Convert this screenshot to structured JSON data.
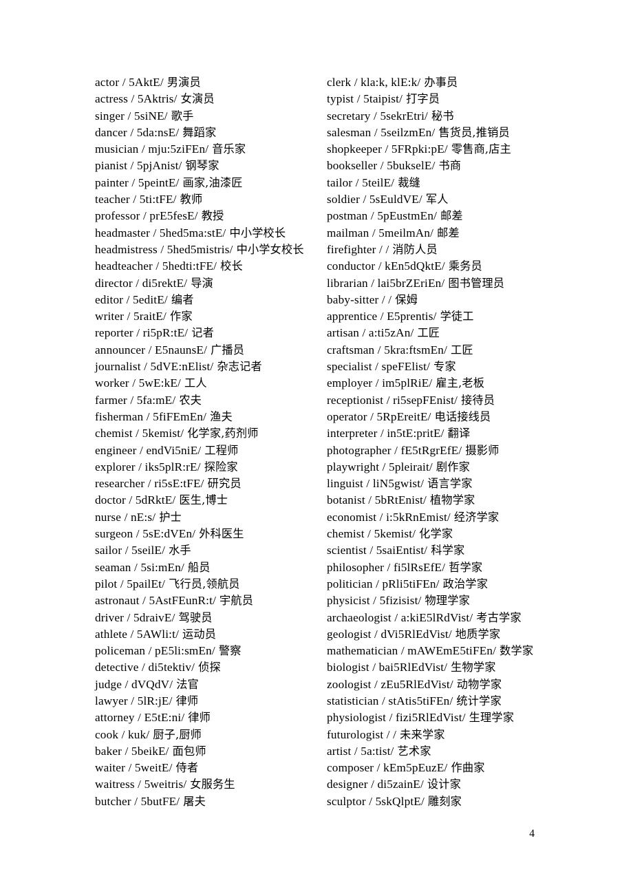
{
  "document": {
    "page_number": "4",
    "separator": "/",
    "phonetic_close": "/"
  },
  "columns": {
    "left": [
      {
        "word": "actor",
        "phonetic": "5AktE",
        "gloss": "男演员"
      },
      {
        "word": "actress",
        "phonetic": "5Aktris",
        "gloss": "女演员"
      },
      {
        "word": "singer",
        "phonetic": "5siNE",
        "gloss": "歌手"
      },
      {
        "word": "dancer",
        "phonetic": "5da:nsE",
        "gloss": "舞蹈家"
      },
      {
        "word": "musician",
        "phonetic": "mju:5ziFEn",
        "gloss": "音乐家"
      },
      {
        "word": "pianist",
        "phonetic": "5pjAnist",
        "gloss": "钢琴家"
      },
      {
        "word": "painter",
        "phonetic": "5peintE",
        "gloss": "画家,油漆匠"
      },
      {
        "word": "teacher",
        "phonetic": "5ti:tFE",
        "gloss": "教师"
      },
      {
        "word": "professor",
        "phonetic": "prE5fesE",
        "gloss": "教授"
      },
      {
        "word": "headmaster",
        "phonetic": "5hed5ma:stE",
        "gloss": "中小学校长"
      },
      {
        "word": "headmistress",
        "phonetic": "5hed5mistris",
        "gloss": "中小学女校长"
      },
      {
        "word": "headteacher",
        "phonetic": "5hedti:tFE",
        "gloss": "校长"
      },
      {
        "word": "director",
        "phonetic": "di5rektE",
        "gloss": "导演"
      },
      {
        "word": "editor",
        "phonetic": "5editE",
        "gloss": "编者"
      },
      {
        "word": "writer",
        "phonetic": "5raitE",
        "gloss": "作家"
      },
      {
        "word": "reporter",
        "phonetic": "ri5pR:tE",
        "gloss": "记者"
      },
      {
        "word": "announcer",
        "phonetic": "E5naunsE",
        "gloss": "广播员"
      },
      {
        "word": "journalist",
        "phonetic": "5dVE:nElist",
        "gloss": "杂志记者"
      },
      {
        "word": "worker",
        "phonetic": "5wE:kE",
        "gloss": "工人"
      },
      {
        "word": "farmer",
        "phonetic": "5fa:mE",
        "gloss": "农夫"
      },
      {
        "word": "fisherman",
        "phonetic": "5fiFEmEn",
        "gloss": "渔夫"
      },
      {
        "word": "chemist",
        "phonetic": "5kemist",
        "gloss": "化学家,药剂师"
      },
      {
        "word": "engineer",
        "phonetic": "endVi5niE",
        "gloss": "工程师"
      },
      {
        "word": "explorer",
        "phonetic": "iks5plR:rE",
        "gloss": "探险家"
      },
      {
        "word": "researcher",
        "phonetic": "ri5sE:tFE",
        "gloss": "研究员"
      },
      {
        "word": "doctor",
        "phonetic": "5dRktE",
        "gloss": "医生,博士"
      },
      {
        "word": "nurse",
        "phonetic": "nE:s",
        "gloss": "护士"
      },
      {
        "word": "surgeon",
        "phonetic": "5sE:dVEn",
        "gloss": "外科医生"
      },
      {
        "word": "sailor",
        "phonetic": "5seilE",
        "gloss": "水手"
      },
      {
        "word": "seaman",
        "phonetic": "5si:mEn",
        "gloss": "船员"
      },
      {
        "word": "pilot",
        "phonetic": "5pailEt",
        "gloss": "飞行员,领航员"
      },
      {
        "word": "astronaut",
        "phonetic": "5AstFEunR:t",
        "gloss": "宇航员"
      },
      {
        "word": "driver",
        "phonetic": "5draivE",
        "gloss": "驾驶员"
      },
      {
        "word": "athlete",
        "phonetic": "5AWli:t",
        "gloss": "运动员"
      },
      {
        "word": "policeman",
        "phonetic": "pE5li:smEn",
        "gloss": "警察"
      },
      {
        "word": "detective",
        "phonetic": "di5tektiv",
        "gloss": "侦探"
      },
      {
        "word": "judge",
        "phonetic": "dVQdV",
        "gloss": "法官"
      },
      {
        "word": "lawyer",
        "phonetic": "5lR:jE",
        "gloss": "律师"
      },
      {
        "word": "attorney",
        "phonetic": "E5tE:ni",
        "gloss": "律师"
      },
      {
        "word": "cook",
        "phonetic": "kuk",
        "gloss": "厨子,厨师"
      },
      {
        "word": "baker",
        "phonetic": "5beikE",
        "gloss": "面包师"
      },
      {
        "word": "waiter",
        "phonetic": "5weitE",
        "gloss": "侍者"
      },
      {
        "word": "waitress",
        "phonetic": "5weitris",
        "gloss": "女服务生"
      },
      {
        "word": "butcher",
        "phonetic": "5butFE",
        "gloss": "屠夫"
      }
    ],
    "right": [
      {
        "word": "clerk",
        "phonetic": "kla:k, klE:k",
        "gloss": "办事员"
      },
      {
        "word": "typist",
        "phonetic": "5taipist",
        "gloss": "打字员"
      },
      {
        "word": "secretary",
        "phonetic": "5sekrEtri",
        "gloss": "秘书"
      },
      {
        "word": "salesman",
        "phonetic": "5seilzmEn",
        "gloss": "售货员,推销员"
      },
      {
        "word": "shopkeeper",
        "phonetic": "5FRpki:pE",
        "gloss": "零售商,店主"
      },
      {
        "word": "bookseller",
        "phonetic": "5bukselE",
        "gloss": "书商"
      },
      {
        "word": "tailor",
        "phonetic": "5teilE",
        "gloss": "裁缝"
      },
      {
        "word": "soldier",
        "phonetic": "5sEuldVE",
        "gloss": "军人"
      },
      {
        "word": "postman",
        "phonetic": "5pEustmEn",
        "gloss": "邮差"
      },
      {
        "word": "mailman",
        "phonetic": "5meilmAn",
        "gloss": "邮差"
      },
      {
        "word": "firefighter",
        "phonetic": "",
        "gloss": "消防人员"
      },
      {
        "word": "conductor",
        "phonetic": "kEn5dQktE",
        "gloss": "乘务员"
      },
      {
        "word": "librarian",
        "phonetic": "lai5brZEriEn",
        "gloss": "图书管理员"
      },
      {
        "word": "baby-sitter",
        "phonetic": "",
        "gloss": "保姆"
      },
      {
        "word": "apprentice",
        "phonetic": "E5prentis",
        "gloss": "学徒工"
      },
      {
        "word": "artisan",
        "phonetic": "a:ti5zAn",
        "gloss": "工匠"
      },
      {
        "word": "craftsman",
        "phonetic": "5kra:ftsmEn",
        "gloss": "工匠"
      },
      {
        "word": "specialist",
        "phonetic": "speFElist",
        "gloss": "专家"
      },
      {
        "word": "employer",
        "phonetic": "im5plRiE",
        "gloss": "雇主,老板"
      },
      {
        "word": "receptionist",
        "phonetic": "ri5sepFEnist",
        "gloss": "接待员"
      },
      {
        "word": "operator",
        "phonetic": "5RpEreitE",
        "gloss": "电话接线员"
      },
      {
        "word": "interpreter",
        "phonetic": "in5tE:pritE",
        "gloss": "翻译"
      },
      {
        "word": "photographer",
        "phonetic": "fE5tRgrEfE",
        "gloss": "摄影师"
      },
      {
        "word": "playwright",
        "phonetic": "5pleirait",
        "gloss": "剧作家"
      },
      {
        "word": "linguist",
        "phonetic": "liN5gwist",
        "gloss": "语言学家"
      },
      {
        "word": "botanist",
        "phonetic": "5bRtEnist",
        "gloss": "植物学家"
      },
      {
        "word": "economist",
        "phonetic": "i:5kRnEmist",
        "gloss": "经济学家"
      },
      {
        "word": "chemist",
        "phonetic": "5kemist",
        "gloss": "化学家"
      },
      {
        "word": "scientist",
        "phonetic": "5saiEntist",
        "gloss": "科学家"
      },
      {
        "word": "philosopher",
        "phonetic": "fi5lRsEfE",
        "gloss": "哲学家"
      },
      {
        "word": "politician",
        "phonetic": "pRli5tiFEn",
        "gloss": "政治学家"
      },
      {
        "word": "physicist",
        "phonetic": "5fizisist",
        "gloss": "物理学家"
      },
      {
        "word": "archaeologist",
        "phonetic": "a:kiE5lRdVist",
        "gloss": "考古学家"
      },
      {
        "word": "geologist",
        "phonetic": "dVi5RlEdVist",
        "gloss": "地质学家"
      },
      {
        "word": "mathematician",
        "phonetic": "mAWEmE5tiFEn",
        "gloss": "数学家"
      },
      {
        "word": "biologist",
        "phonetic": "bai5RlEdVist",
        "gloss": "生物学家"
      },
      {
        "word": "zoologist",
        "phonetic": "zEu5RlEdVist",
        "gloss": "动物学家"
      },
      {
        "word": "statistician",
        "phonetic": "stAtis5tiFEn",
        "gloss": "统计学家"
      },
      {
        "word": "physiologist",
        "phonetic": "fizi5RlEdVist",
        "gloss": "生理学家"
      },
      {
        "word": "futurologist",
        "phonetic": "",
        "gloss": "未来学家"
      },
      {
        "word": "artist",
        "phonetic": "5a:tist",
        "gloss": "艺术家"
      },
      {
        "word": "composer",
        "phonetic": "kEm5pEuzE",
        "gloss": "作曲家"
      },
      {
        "word": "designer",
        "phonetic": "di5zainE",
        "gloss": "设计家"
      },
      {
        "word": "sculptor",
        "phonetic": "5skQlptE",
        "gloss": "雕刻家"
      }
    ]
  }
}
